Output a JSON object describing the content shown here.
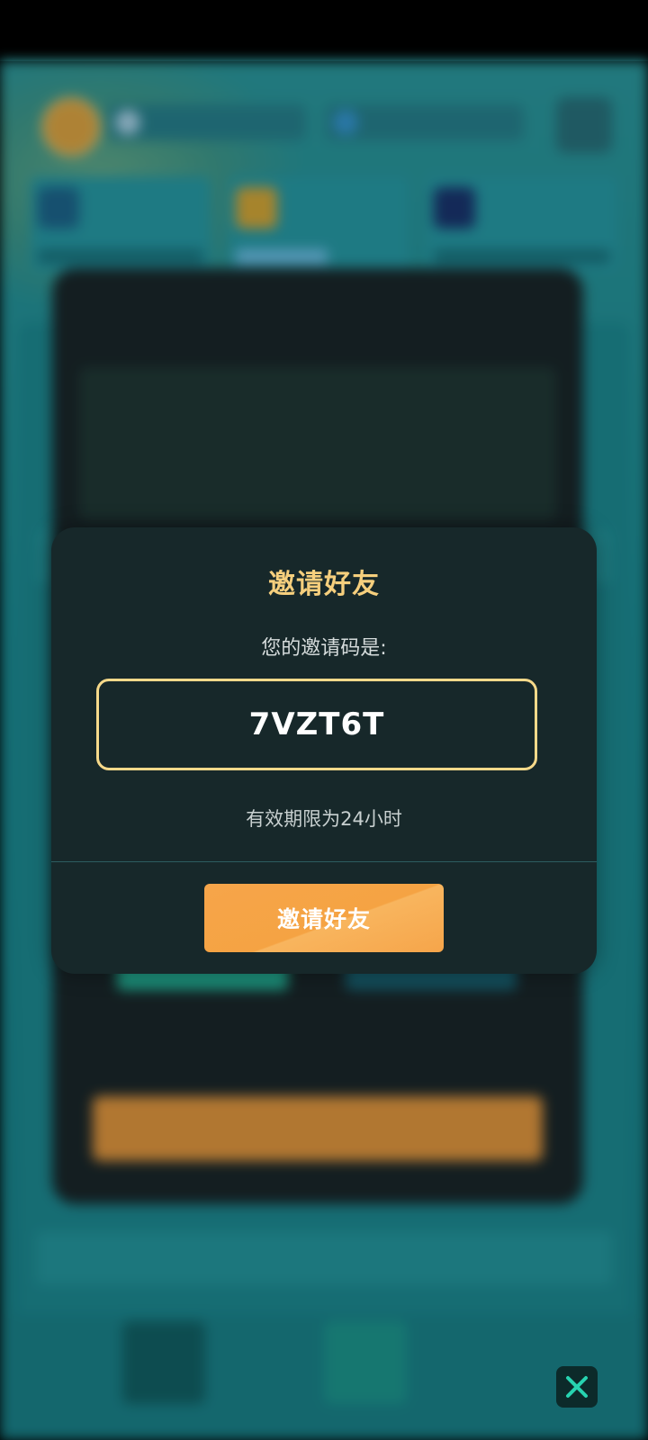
{
  "dialog": {
    "title": "邀请好友",
    "subtitle": "您的邀请码是:",
    "invite_code": "7VZT6T",
    "expiry_note": "有效期限为24小时",
    "button_label": "邀请好友"
  },
  "close_button": {
    "icon": "close-icon",
    "color": "#27d3b0"
  },
  "colors": {
    "accent_gold": "#f6cf7d",
    "button_orange": "#f6a54a",
    "dialog_bg": "#17282a"
  }
}
